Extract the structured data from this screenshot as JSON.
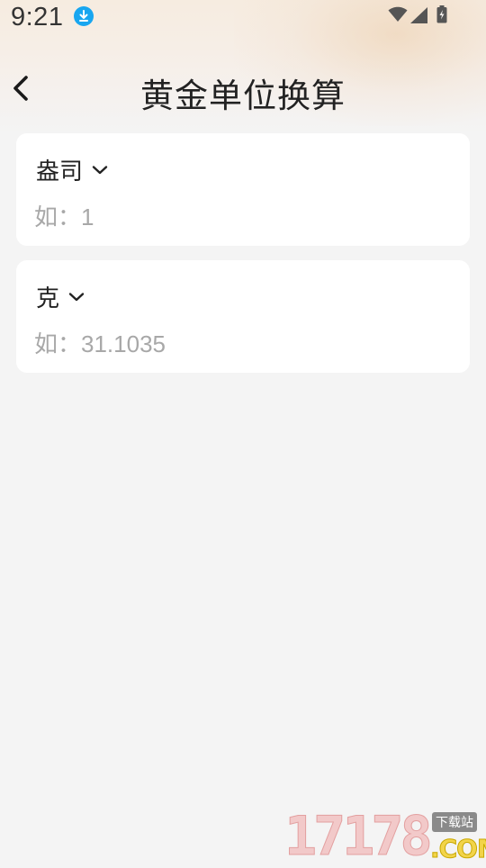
{
  "status_bar": {
    "time": "9:21",
    "icons": [
      "download-icon",
      "wifi-icon",
      "cell-signal-icon",
      "battery-charging-icon"
    ]
  },
  "header": {
    "title": "黄金单位换算",
    "back_icon": "chevron-left-icon"
  },
  "converter": {
    "cards": [
      {
        "unit": "盎司",
        "placeholder": "如：1"
      },
      {
        "unit": "克",
        "placeholder": "如：31.1035"
      }
    ]
  },
  "watermark": {
    "number": "17178",
    "tag": "下载站",
    "suffix": ".COM"
  },
  "colors": {
    "background": "#f4f4f4",
    "card": "#ffffff",
    "placeholder": "#a8a8a8",
    "download_badge": "#18a6f0"
  }
}
